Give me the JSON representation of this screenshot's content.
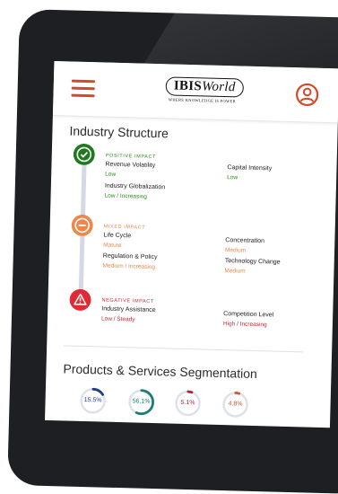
{
  "header": {
    "logo_main": "IBIS",
    "logo_italic": "World",
    "logo_tagline": "Where Knowledge Is Power"
  },
  "industry_structure": {
    "title": "Industry Structure",
    "groups": [
      {
        "impact": "POSITIVE IMPACT",
        "color": "#1f7a1f",
        "factors": [
          {
            "name": "Revenue Volatility",
            "value": "Low"
          },
          {
            "name": "Capital Intensity",
            "value": "Low"
          },
          {
            "name": "Industry Globalization",
            "value": "Low / Increasing"
          }
        ]
      },
      {
        "impact": "MIXED IMPACT",
        "color": "#f0874a",
        "factors": [
          {
            "name": "Life Cycle",
            "value": "Mature"
          },
          {
            "name": "Concentration",
            "value": "Medium"
          },
          {
            "name": "Regulation & Policy",
            "value": "Medium / Increasing"
          },
          {
            "name": "Technology Change",
            "value": "Medium"
          }
        ]
      },
      {
        "impact": "NEGATIVE IMPACT",
        "color": "#e02b37",
        "factors": [
          {
            "name": "Industry Assistance",
            "value": "Low / Steady"
          },
          {
            "name": "Competition Level",
            "value": "High / Increasing"
          }
        ]
      }
    ]
  },
  "products": {
    "title": "Products & Services Segmentation",
    "segments": [
      {
        "label": "15.5%",
        "value": 15.5,
        "color": "#1f3f86",
        "text_color": "#1f3f86"
      },
      {
        "label": "56.1%",
        "value": 56.1,
        "color": "#1a7d7a",
        "text_color": "#1a7d7a"
      },
      {
        "label": "5.1%",
        "value": 5.1,
        "color": "#b3223a",
        "text_color": "#b3223a"
      },
      {
        "label": "4.8%",
        "value": 4.8,
        "color": "#d2573a",
        "text_color": "#d2573a"
      }
    ]
  }
}
